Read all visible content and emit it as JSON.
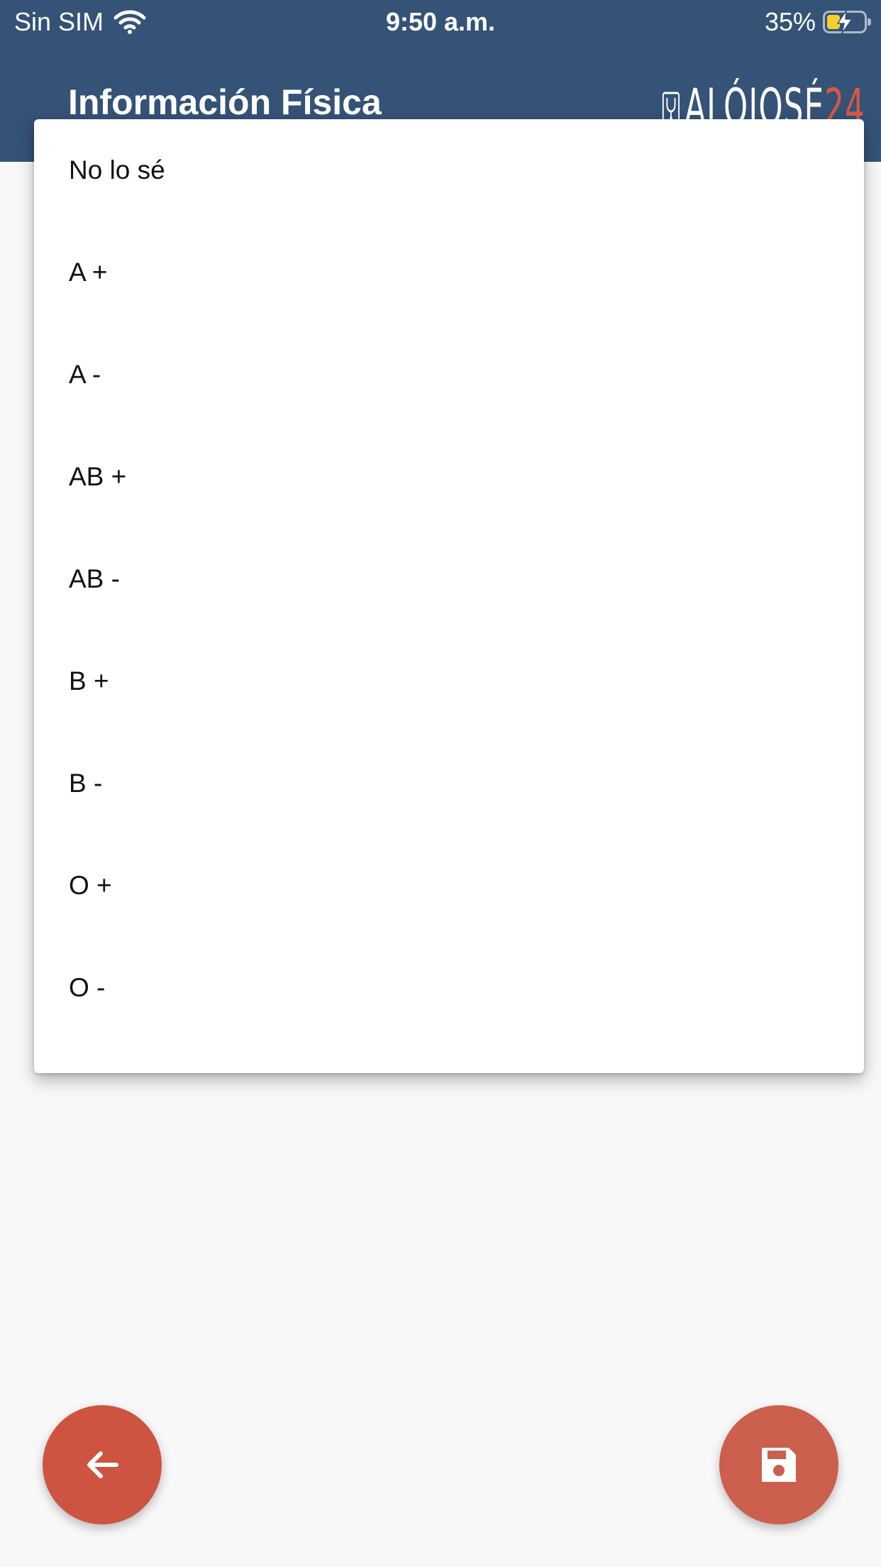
{
  "status_bar": {
    "carrier": "Sin SIM",
    "time": "9:50 a.m.",
    "battery_percent": "35%",
    "battery_level": 0.35,
    "icons": [
      "wifi-icon",
      "battery-charging-icon"
    ]
  },
  "app_bar": {
    "title": "Información Física",
    "logo": {
      "main": "ALÓJOSÉ",
      "number": "24",
      "number_color": "#d65845"
    },
    "color": "#355277"
  },
  "dropdown": {
    "options": [
      {
        "label": "No lo sé"
      },
      {
        "label": "A +"
      },
      {
        "label": "A -"
      },
      {
        "label": "AB +"
      },
      {
        "label": "AB -"
      },
      {
        "label": "B +"
      },
      {
        "label": "B -"
      },
      {
        "label": "O +"
      },
      {
        "label": "O -"
      }
    ]
  },
  "actions": {
    "back": {
      "icon": "arrow-left-icon",
      "color": "#cc5440"
    },
    "save": {
      "icon": "floppy-disk-icon",
      "color": "#cc5f4d"
    }
  }
}
